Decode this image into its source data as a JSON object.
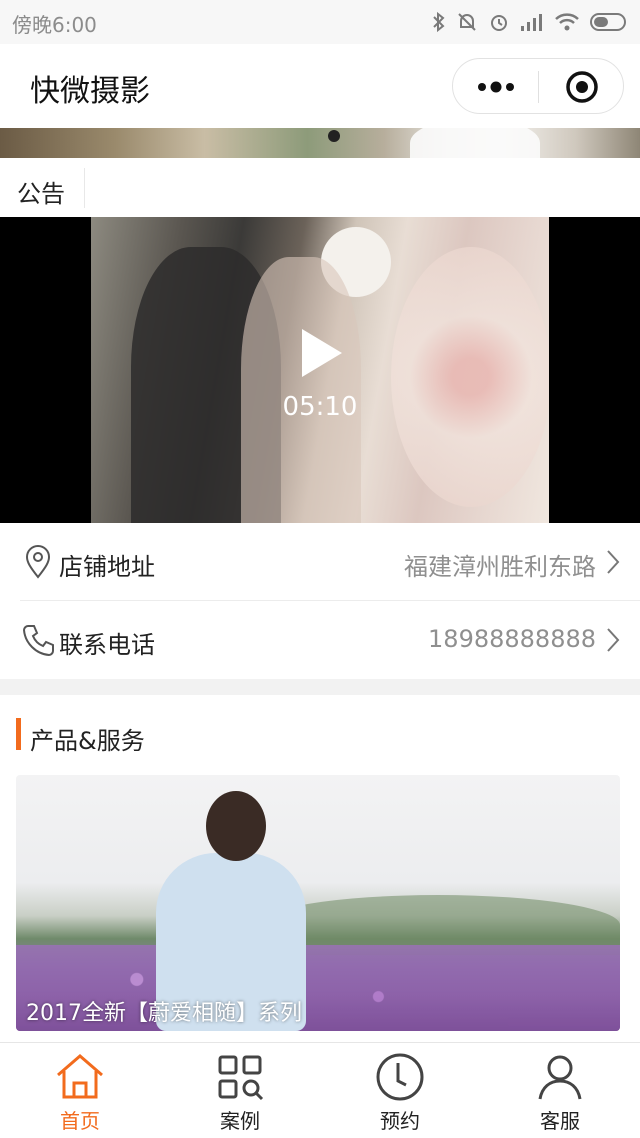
{
  "status_bar": {
    "time": "傍晚6:00"
  },
  "nav": {
    "title": "快微摄影"
  },
  "notice": {
    "label": "公告"
  },
  "video": {
    "duration": "05:10"
  },
  "info_rows": [
    {
      "label": "店铺地址",
      "value": "福建漳州胜利东路",
      "icon": "location-pin-icon"
    },
    {
      "label": "联系电话",
      "value": "18988888888",
      "icon": "phone-icon"
    }
  ],
  "products": {
    "heading": "产品&服务",
    "items": [
      {
        "caption": "2017全新【蔚爱相随】系列"
      }
    ]
  },
  "tabs": [
    {
      "label": "首页",
      "icon": "home-icon",
      "active": true
    },
    {
      "label": "案例",
      "icon": "grid-search-icon",
      "active": false
    },
    {
      "label": "预约",
      "icon": "clock-icon",
      "active": false
    },
    {
      "label": "客服",
      "icon": "person-icon",
      "active": false
    }
  ],
  "colors": {
    "accent": "#f26b1d",
    "muted_text": "#8f8f8f"
  }
}
